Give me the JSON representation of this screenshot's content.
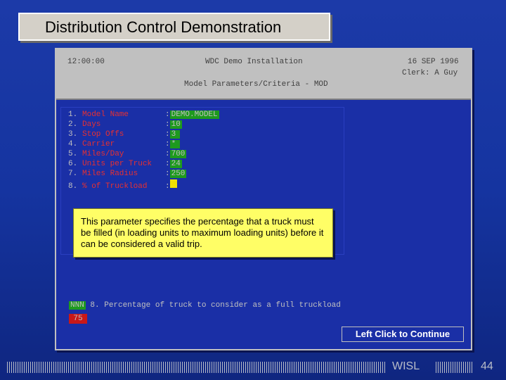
{
  "title": "Distribution Control Demonstration",
  "terminal": {
    "time": "12:00:00",
    "installation": "WDC Demo Installation",
    "date": "16 SEP 1996",
    "clerk": "Clerk: A Guy",
    "screen_title": "Model Parameters/Criteria - MOD"
  },
  "menu_items": [
    {
      "num": "1.",
      "label": "Model Name",
      "value": "DEMO.MODEL"
    },
    {
      "num": "2.",
      "label": "Days",
      "value": "10"
    },
    {
      "num": "3.",
      "label": "Stop Offs",
      "value": "3"
    },
    {
      "num": "4.",
      "label": "Carrier",
      "value": "*"
    },
    {
      "num": "5.",
      "label": "Miles/Day",
      "value": "700"
    },
    {
      "num": "6.",
      "label": "Units per Truck",
      "value": "24"
    },
    {
      "num": "7.",
      "label": "Miles Radius",
      "value": "250"
    },
    {
      "num": "8.",
      "label": "% of Truckload",
      "value": ""
    }
  ],
  "tooltip": "This parameter specifies the percentage that a truck must be filled (in loading units to maximum loading units) before it can be considered a valid trip.",
  "status": {
    "format": "NNN",
    "description": "8. Percentage of truck to consider as a full truckload",
    "input_value": "75"
  },
  "continue_label": "Left Click to Continue",
  "footer": {
    "brand": "WISL",
    "slide_number": "44"
  },
  "colors": {
    "background": "#1534a0",
    "label_red": "#e83030",
    "value_green": "#1e9a1e",
    "tooltip_yellow": "#fffe66"
  }
}
